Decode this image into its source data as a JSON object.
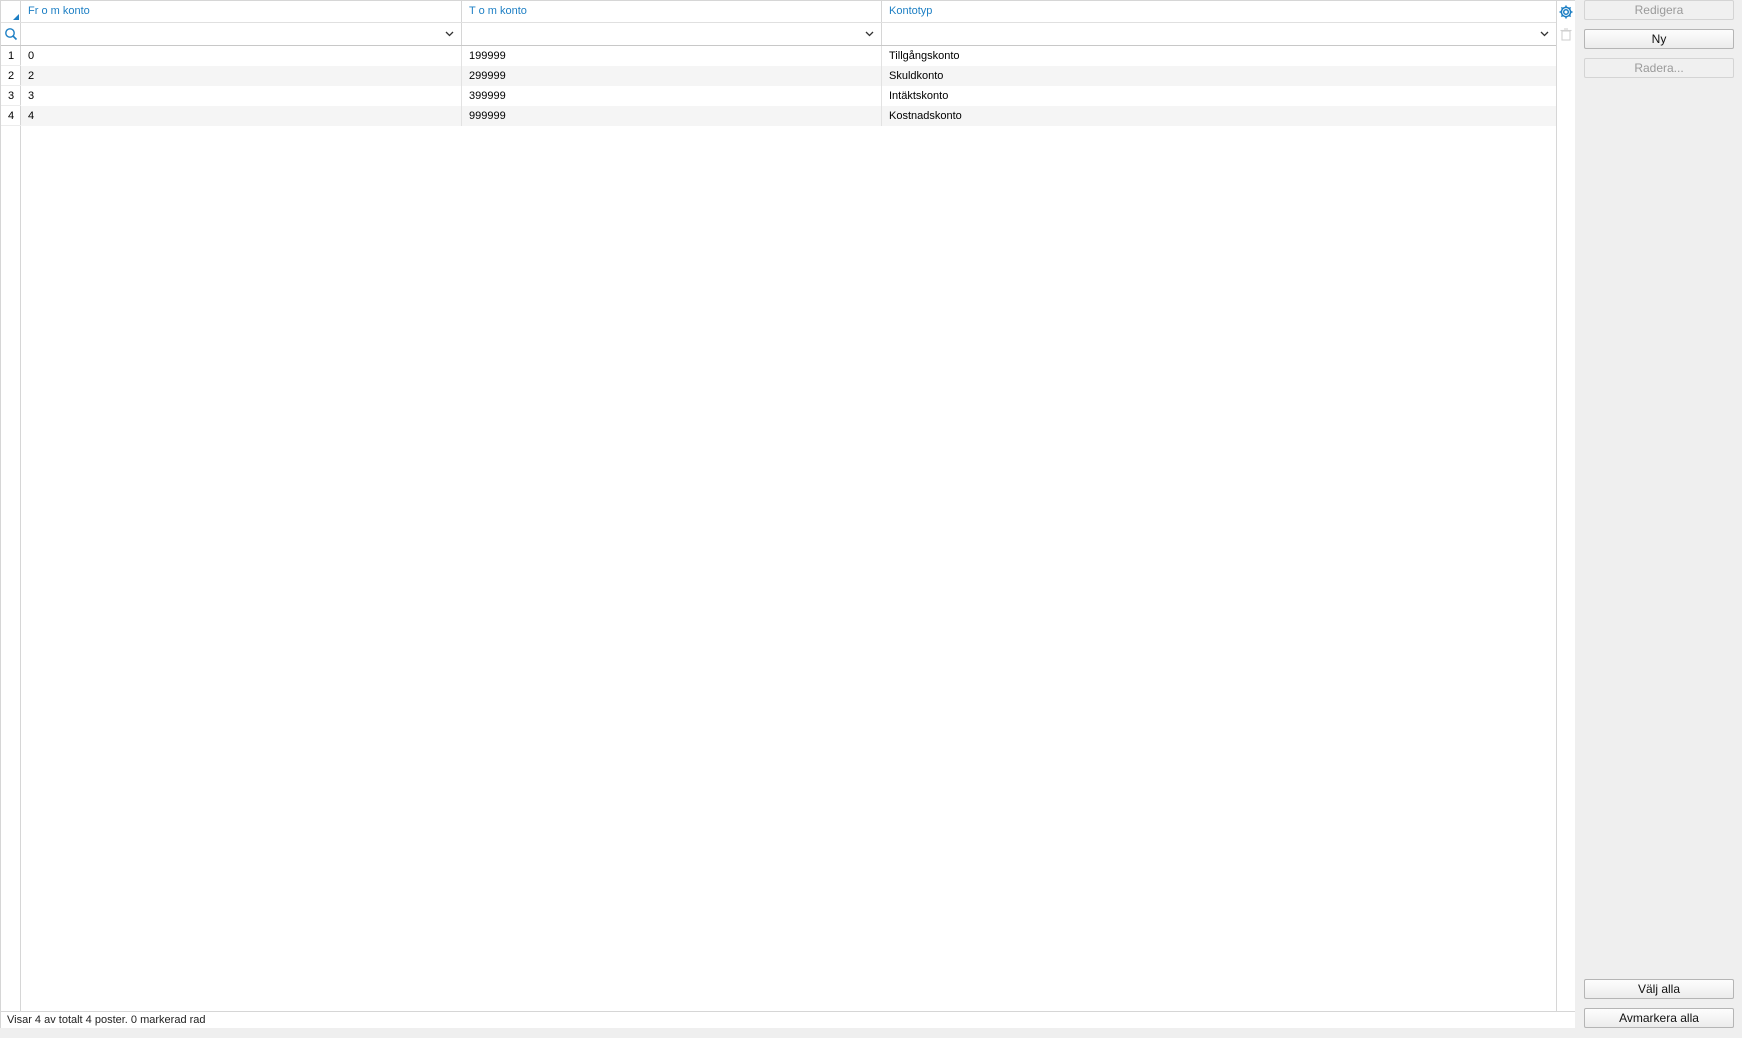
{
  "grid": {
    "columns": [
      {
        "label": "Fr o m konto"
      },
      {
        "label": "T o m konto"
      },
      {
        "label": "Kontotyp"
      }
    ],
    "rows": [
      {
        "num": "1",
        "from": "0",
        "to": "199999",
        "type": "Tillgångskonto"
      },
      {
        "num": "2",
        "from": "2",
        "to": "299999",
        "type": "Skuldkonto"
      },
      {
        "num": "3",
        "from": "3",
        "to": "399999",
        "type": "Intäktskonto"
      },
      {
        "num": "4",
        "from": "4",
        "to": "999999",
        "type": "Kostnadskonto"
      }
    ],
    "filters": [
      "",
      "",
      ""
    ]
  },
  "status": {
    "text": "Visar 4 av totalt 4 poster. 0 markerad rad"
  },
  "actions": {
    "edit_label": "Redigera",
    "new_label": "Ny",
    "delete_label": "Radera...",
    "select_all_label": "Välj alla",
    "deselect_all_label": "Avmarkera alla"
  },
  "colors": {
    "accent": "#1d7fc4",
    "panel": "#efefef"
  },
  "icons": [
    "settings-gear-icon",
    "search-icon",
    "chevron-down-icon",
    "trash-icon",
    "sort-corner-icon"
  ]
}
